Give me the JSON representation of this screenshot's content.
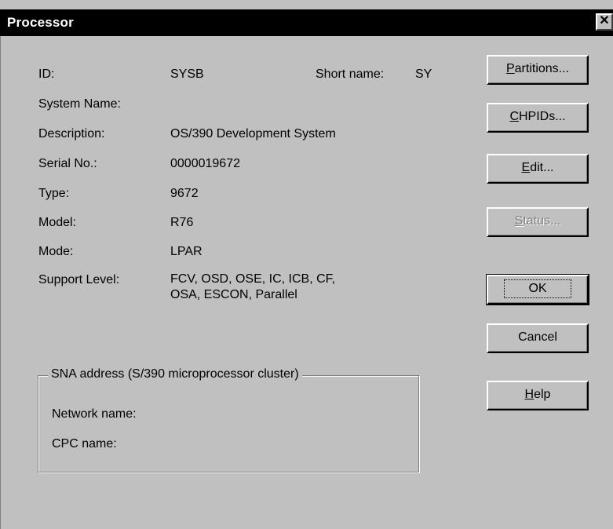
{
  "window": {
    "title": "Processor",
    "close_symbol": "✕"
  },
  "fields": {
    "id_label": "ID:",
    "id_value": "SYSB",
    "short_name_label": "Short name:",
    "short_name_value": "SY",
    "system_name_label": "System Name:",
    "system_name_value": "",
    "description_label": "Description:",
    "description_value": "OS/390 Development System",
    "serial_label": "Serial No.:",
    "serial_value": "0000019672",
    "type_label": "Type:",
    "type_value": "9672",
    "model_label": "Model:",
    "model_value": "R76",
    "mode_label": "Mode:",
    "mode_value": "LPAR",
    "support_level_label": "Support Level:",
    "support_level_value": "FCV, OSD, OSE, IC, ICB, CF,\nOSA, ESCON, Parallel"
  },
  "sna_group": {
    "legend": "SNA address (S/390 microprocessor cluster)",
    "network_name_label": "Network name:",
    "cpc_name_label": "CPC name:"
  },
  "buttons": {
    "partitions": {
      "mnemonic": "P",
      "rest": "artitions..."
    },
    "chpids": {
      "mnemonic": "C",
      "rest": "HPIDs..."
    },
    "edit": {
      "mnemonic": "E",
      "rest": "dit..."
    },
    "status": {
      "mnemonic": "S",
      "rest": "tatus..."
    },
    "ok": {
      "label": "OK"
    },
    "cancel": {
      "label": "Cancel"
    },
    "help": {
      "mnemonic": "H",
      "rest": "elp"
    }
  }
}
